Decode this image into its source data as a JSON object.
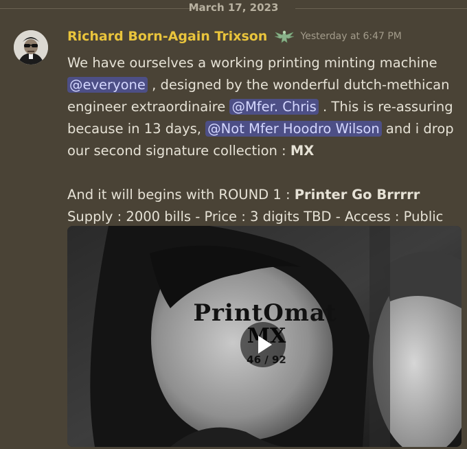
{
  "date_divider": {
    "text": "March 17, 2023"
  },
  "message": {
    "author": "Richard Born-Again Trixson",
    "badge_icon": "eagle-emblem-icon",
    "timestamp": "Yesterday at 6:47 PM",
    "paragraph1": {
      "t1": "We have ourselves a working printing minting machine ",
      "mention1": "@everyone",
      "t2": " , designed by the wonderful dutch-methican engineer extraordinaire ",
      "mention2": "@Mfer. Chris",
      "t3": " . This is re-assuring because in 13 days, ",
      "mention3": "@Not Mfer Hoodro Wilson",
      "t4": " and i drop our second signature collection :  ",
      "bold1": "MX"
    },
    "paragraph2": {
      "line1_text": "And it will begins with ROUND 1 : ",
      "line1_bold": "Printer Go Brrrrr",
      "line2_text": "Supply : 2000 bills - Price : 3 digits TBD - Access : Public"
    },
    "video": {
      "overlay_title": "PrintOmat",
      "overlay_subtitle": "MX",
      "overlay_count": "46 / 92",
      "play_icon": "play-icon"
    }
  },
  "colors": {
    "background": "#4a4336",
    "username": "#e9c43c",
    "mention_bg": "#4d4f86",
    "mention_text": "#d5d8ff"
  }
}
